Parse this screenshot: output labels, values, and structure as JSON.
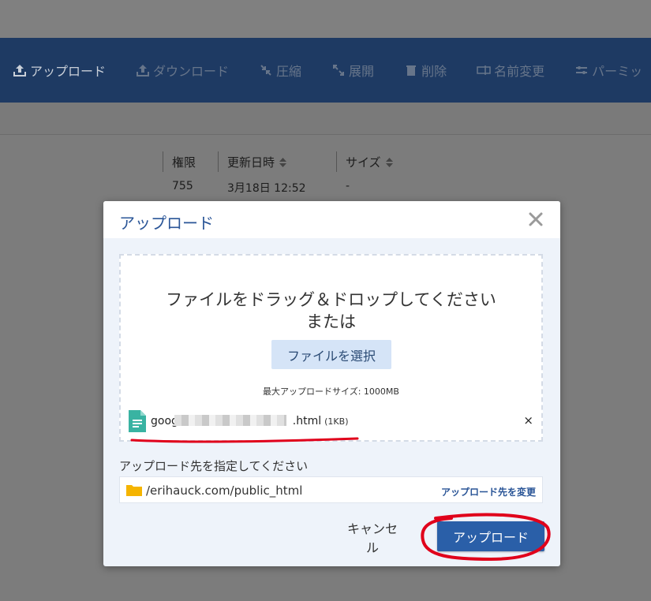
{
  "toolbar": {
    "items": [
      {
        "label": "アップロード",
        "icon": "upload-icon"
      },
      {
        "label": "ダウンロード",
        "icon": "download-icon"
      },
      {
        "label": "圧縮",
        "icon": "compress-icon"
      },
      {
        "label": "展開",
        "icon": "expand-icon"
      },
      {
        "label": "削除",
        "icon": "trash-icon"
      },
      {
        "label": "名前変更",
        "icon": "rename-icon"
      },
      {
        "label": "パーミッ",
        "icon": "permission-icon"
      }
    ]
  },
  "table": {
    "headers": [
      "権限",
      "更新日時",
      "サイズ"
    ],
    "row": {
      "permission": "755",
      "updated": "3月18日 12:52",
      "size": "-"
    }
  },
  "modal": {
    "title": "アップロード",
    "dropzone": {
      "line1": "ファイルをドラッグ＆ドロップしてください",
      "line2": "または",
      "select_button": "ファイルを選択",
      "max_size": "最大アップロードサイズ: 1000MB"
    },
    "file": {
      "name_prefix": "googl",
      "name_suffix": ".html",
      "size": "(1KB)",
      "remove": "×"
    },
    "destination": {
      "label": "アップロード先を指定してください",
      "path": "/erihauck.com/public_html",
      "change_link": "アップロード先を変更"
    },
    "cancel_button": "キャンセル",
    "upload_button": "アップロード"
  },
  "colors": {
    "toolbar_bg": "#1e3a63",
    "accent": "#2a5fa8",
    "annotation": "#e0001b"
  }
}
